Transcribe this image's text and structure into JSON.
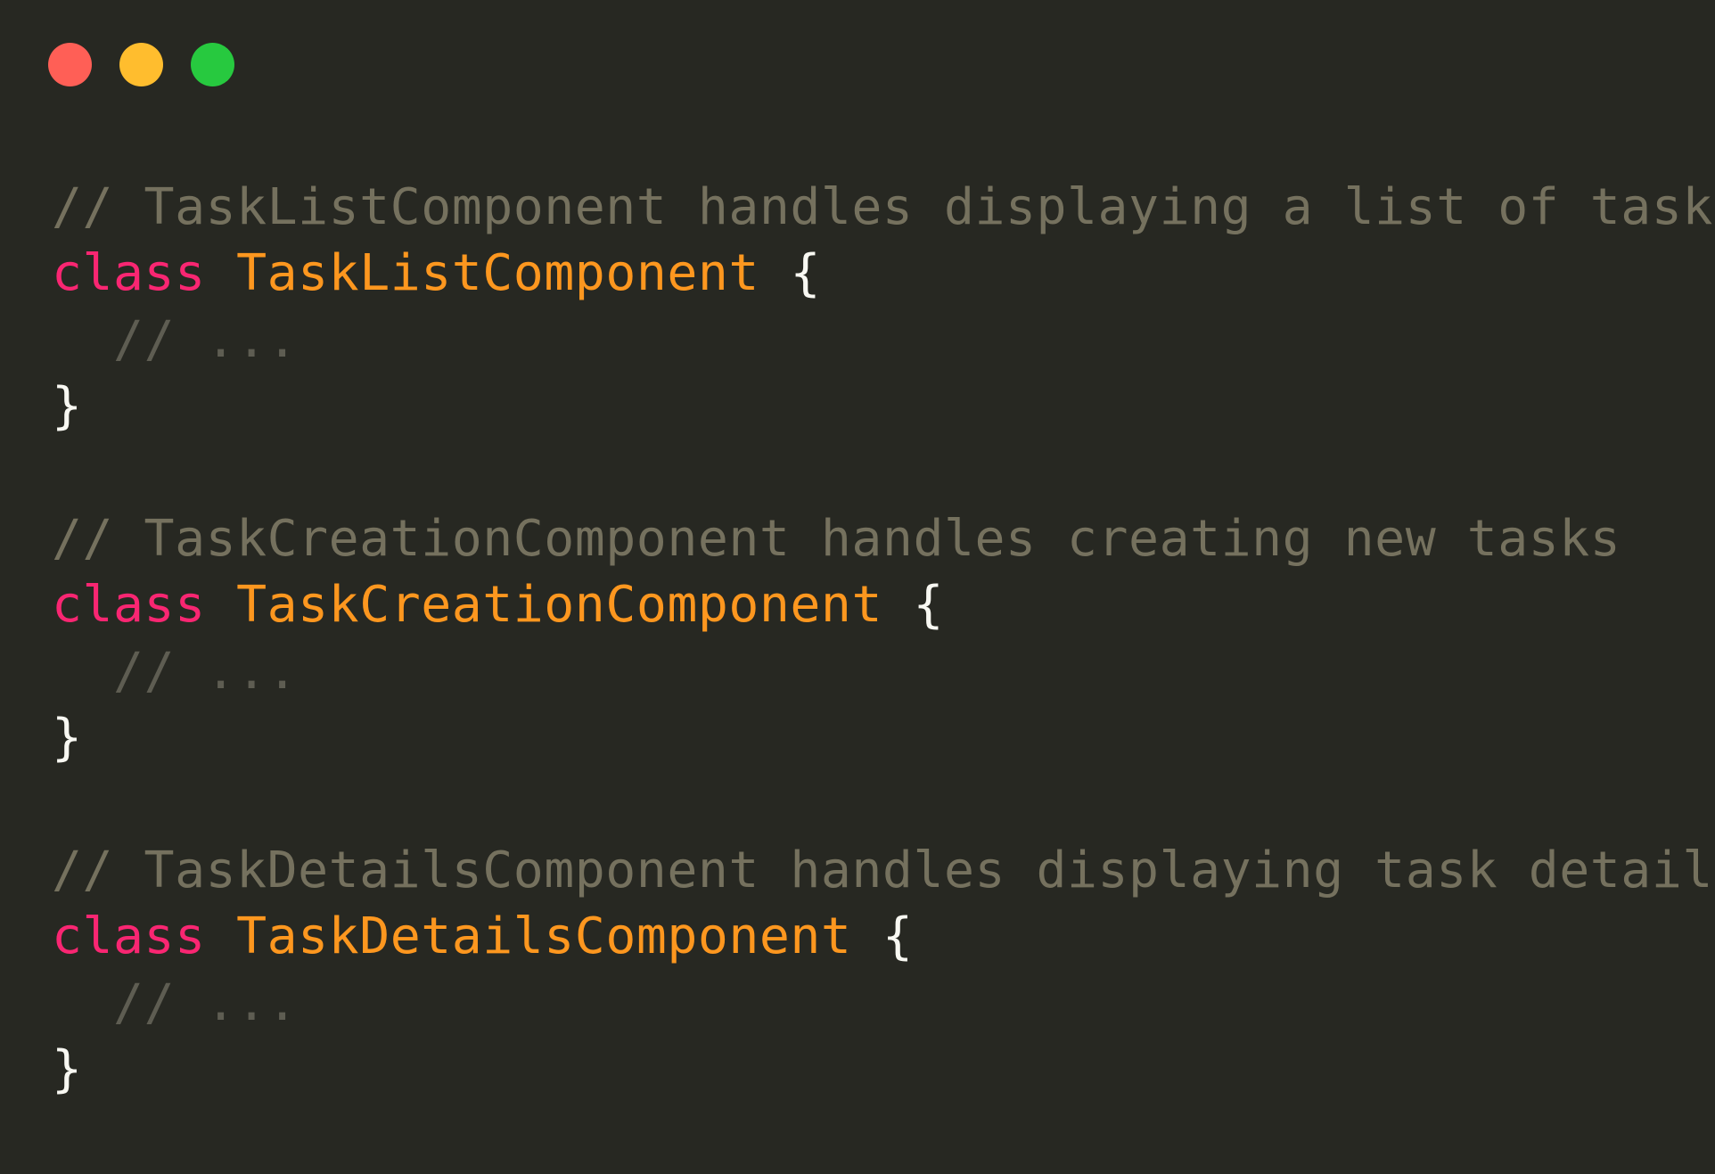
{
  "colors": {
    "background": "#272822",
    "close": "#FF5F56",
    "minimize": "#FFBD2E",
    "zoom": "#27C93F",
    "comment": "#75715E",
    "inner_comment": "#5E5D52",
    "keyword": "#F92672",
    "class_name": "#FD971F",
    "punctuation": "#F8F8F2"
  },
  "window_controls": [
    {
      "name": "close-button",
      "color_key": "close"
    },
    {
      "name": "minimize-button",
      "color_key": "minimize"
    },
    {
      "name": "zoom-button",
      "color_key": "zoom"
    }
  ],
  "code": {
    "blocks": [
      {
        "comment": "// TaskListComponent handles displaying a list of tasks",
        "keyword": "class",
        "class_name": "TaskListComponent",
        "open_brace": "{",
        "body_comment": "// ...",
        "close_brace": "}"
      },
      {
        "comment": "// TaskCreationComponent handles creating new tasks",
        "keyword": "class",
        "class_name": "TaskCreationComponent",
        "open_brace": "{",
        "body_comment": "// ...",
        "close_brace": "}"
      },
      {
        "comment": "// TaskDetailsComponent handles displaying task details",
        "keyword": "class",
        "class_name": "TaskDetailsComponent",
        "open_brace": "{",
        "body_comment": "// ...",
        "close_brace": "}"
      }
    ]
  }
}
